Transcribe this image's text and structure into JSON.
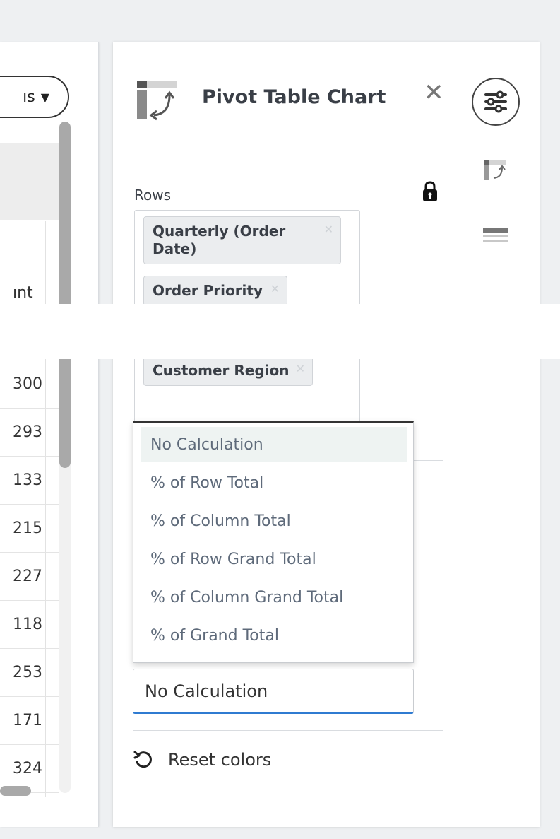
{
  "left_panel": {
    "dropdown_button_text": "ıs",
    "header_partial_text": "ınt",
    "cells": [
      "300",
      "293",
      "133",
      "215",
      "227",
      "118",
      "253",
      "171",
      "324"
    ]
  },
  "panel": {
    "title": "Pivot Table Chart",
    "rows_label": "Rows",
    "chips": [
      "Quarterly (Order Date)",
      "Order Priority",
      "Customer Region"
    ]
  },
  "calculation_dropdown": {
    "options": [
      "No Calculation",
      "% of Row Total",
      "% of Column Total",
      "% of Row Grand Total",
      "% of Column Grand Total",
      "% of Grand Total"
    ],
    "selected_value": "No Calculation"
  },
  "reset": {
    "label": "Reset colors"
  },
  "icons": {
    "pivot_chart": "pivot-table-icon",
    "close": "close-icon",
    "settings": "sliders-icon",
    "lock": "lock-icon",
    "table": "table-icon",
    "reset": "undo-icon"
  },
  "colors": {
    "accent_underline": "#2f7bd1",
    "selected_option_bg": "#eef3f2",
    "option_text": "#5e6a7a"
  }
}
